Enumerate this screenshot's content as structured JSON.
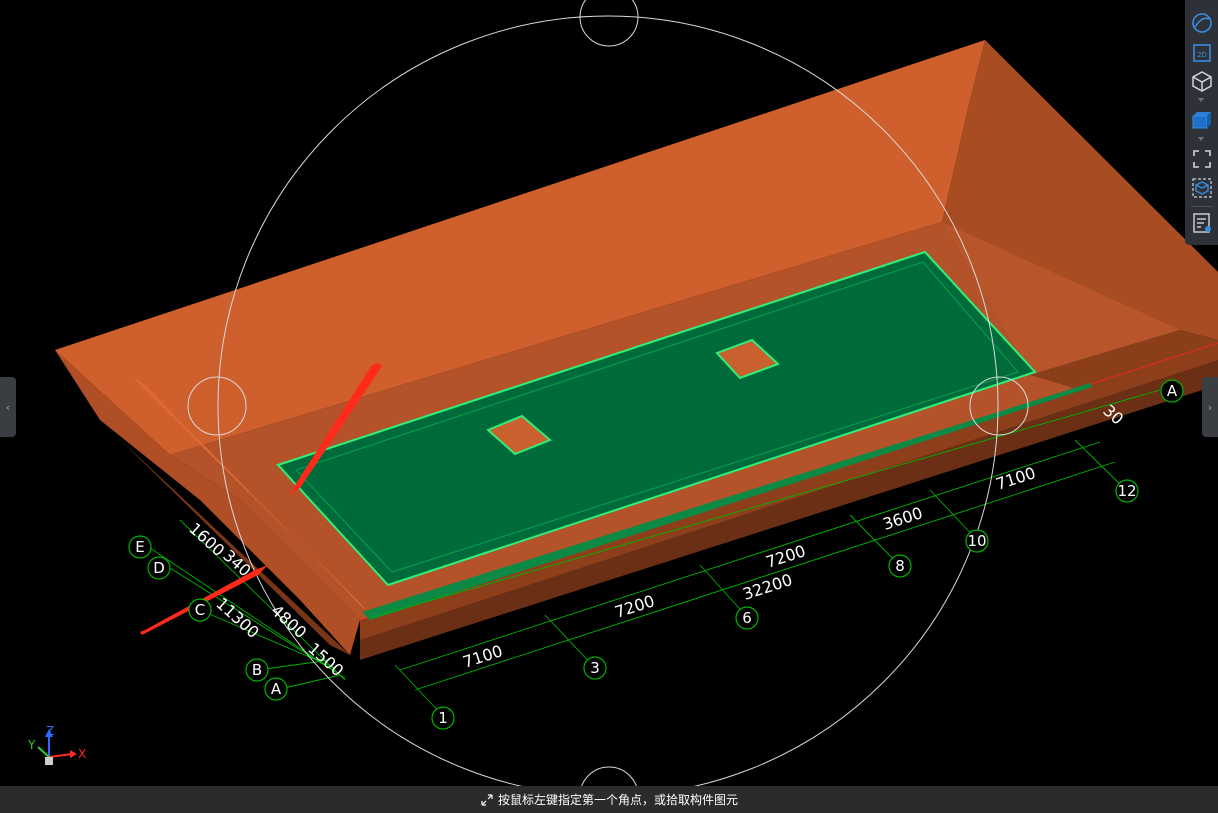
{
  "grid_bubbles": {
    "x_axes": [
      "1",
      "3",
      "6",
      "8",
      "10",
      "12"
    ],
    "y_axes_left": [
      "E",
      "D",
      "C",
      "B",
      "A"
    ],
    "y_axis_right": "A"
  },
  "dimensions": {
    "x_segments": [
      "7100",
      "7200",
      "7200",
      "3600",
      "7100"
    ],
    "x_total": "32200",
    "y_segments": [
      "1600",
      "340",
      "11300",
      "4800",
      "1500"
    ],
    "y_right_partial": "30"
  },
  "axis_triad": {
    "x": "X",
    "y": "Y",
    "z": "Z"
  },
  "statusbar": {
    "message": "按鼠标左键指定第一个角点，或拾取构件图元"
  },
  "toolbar": {
    "icons": [
      "orbit-icon",
      "view-2d-icon",
      "view-3d-icon",
      "solid-box-icon",
      "fit-extents-icon",
      "local-3d-icon",
      "layer-display-icon"
    ],
    "label_2d": "2D"
  },
  "side_handles": {
    "left": "‹",
    "right": "›"
  },
  "colors": {
    "excavation_orange": "#cf5f2c",
    "slab_green": "#006b3a",
    "edge_green": "#2df07a",
    "grid_green": "#00b400",
    "annotation_red": "#ff2a1a"
  }
}
